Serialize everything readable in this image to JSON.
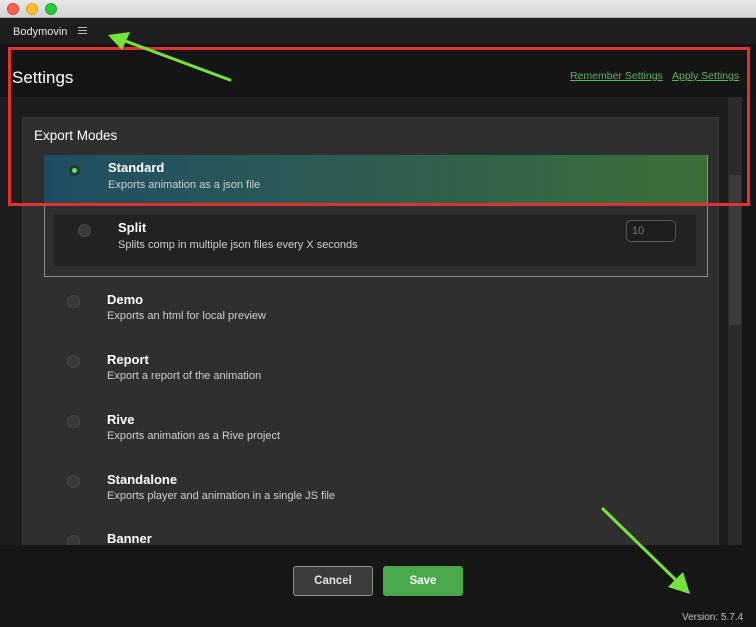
{
  "app": {
    "name": "Bodymovin",
    "version": "Version: 5.7.4"
  },
  "header": {
    "title": "Settings",
    "remember_label": "Remember Settings",
    "apply_label": "Apply Settings"
  },
  "export_modes": {
    "title": "Export Modes",
    "options": [
      {
        "name": "Standard",
        "description": "Exports animation as a json file",
        "selected": true
      },
      {
        "name": "Split",
        "description": "Splits comp in multiple json files every X seconds",
        "selected": false,
        "seconds_placeholder": "10"
      },
      {
        "name": "Demo",
        "description": "Exports an html for local preview",
        "selected": false
      },
      {
        "name": "Report",
        "description": "Export a report of the animation",
        "selected": false
      },
      {
        "name": "Rive",
        "description": "Exports animation as a Rive project",
        "selected": false
      },
      {
        "name": "Standalone",
        "description": "Exports player and animation in a single JS file",
        "selected": false
      },
      {
        "name": "Banner",
        "description": "",
        "selected": false
      }
    ]
  },
  "footer": {
    "cancel_label": "Cancel",
    "save_label": "Save"
  },
  "colors": {
    "accent_green": "#4aa84d",
    "link_green": "#5bb35b",
    "callout_red": "#e13232",
    "arrow_green": "#76e23e"
  }
}
